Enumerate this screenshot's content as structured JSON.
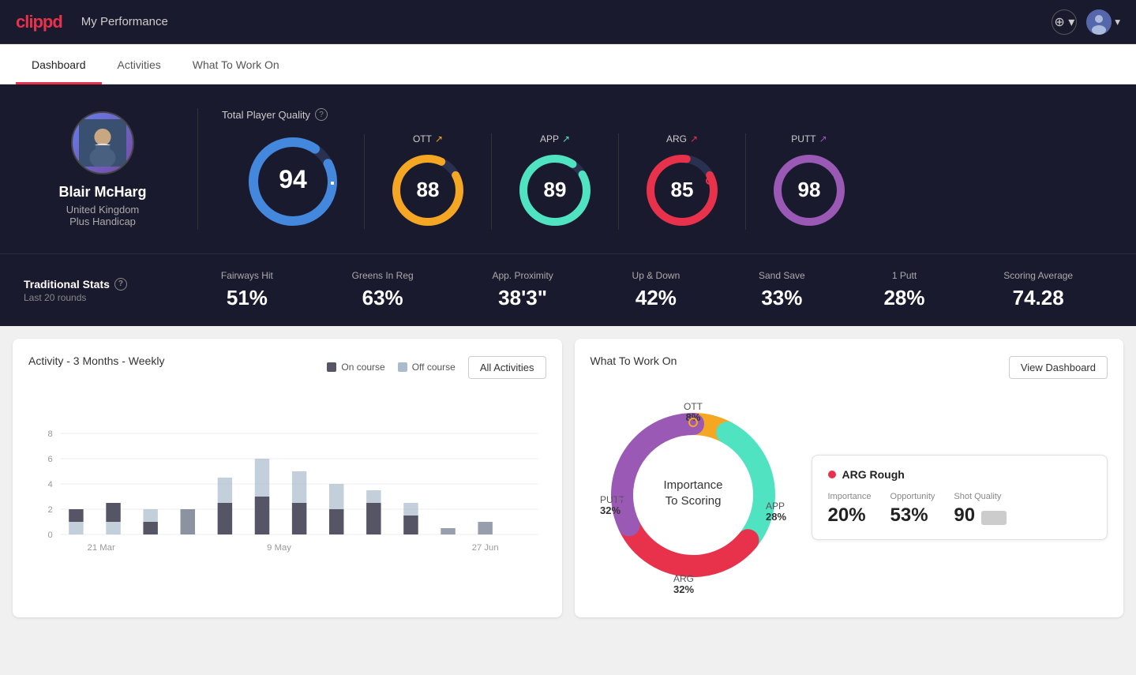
{
  "app": {
    "logo": "clippd",
    "header_title": "My Performance"
  },
  "tabs": [
    {
      "id": "dashboard",
      "label": "Dashboard",
      "active": true
    },
    {
      "id": "activities",
      "label": "Activities",
      "active": false
    },
    {
      "id": "what-to-work-on",
      "label": "What To Work On",
      "active": false
    }
  ],
  "player": {
    "name": "Blair McHarg",
    "country": "United Kingdom",
    "handicap": "Plus Handicap"
  },
  "total_quality": {
    "label": "Total Player Quality",
    "main_value": 94,
    "gauges": [
      {
        "id": "ott",
        "label": "OTT",
        "value": 88,
        "color": "#f5a623",
        "trend": "up"
      },
      {
        "id": "app",
        "label": "APP",
        "value": 89,
        "color": "#50e3c2",
        "trend": "up"
      },
      {
        "id": "arg",
        "label": "ARG",
        "value": 85,
        "color": "#e8314a",
        "trend": "up"
      },
      {
        "id": "putt",
        "label": "PUTT",
        "value": 98,
        "color": "#9b59b6",
        "trend": "up"
      }
    ]
  },
  "traditional_stats": {
    "label": "Traditional Stats",
    "sublabel": "Last 20 rounds",
    "stats": [
      {
        "label": "Fairways Hit",
        "value": "51%"
      },
      {
        "label": "Greens In Reg",
        "value": "63%"
      },
      {
        "label": "App. Proximity",
        "value": "38'3\""
      },
      {
        "label": "Up & Down",
        "value": "42%"
      },
      {
        "label": "Sand Save",
        "value": "33%"
      },
      {
        "label": "1 Putt",
        "value": "28%"
      },
      {
        "label": "Scoring Average",
        "value": "74.28"
      }
    ]
  },
  "activity_chart": {
    "title": "Activity - 3 Months - Weekly",
    "legend": [
      {
        "label": "On course",
        "color": "#555566"
      },
      {
        "label": "Off course",
        "color": "#aabbcc"
      }
    ],
    "all_activities_btn": "All Activities",
    "x_labels": [
      "21 Mar",
      "9 May",
      "27 Jun"
    ],
    "y_labels": [
      "0",
      "2",
      "4",
      "6",
      "8"
    ],
    "bars": [
      {
        "oncourse": 1,
        "offcourse": 1.5
      },
      {
        "oncourse": 1.5,
        "offcourse": 1
      },
      {
        "oncourse": 1,
        "offcourse": 2
      },
      {
        "oncourse": 2,
        "offcourse": 2
      },
      {
        "oncourse": 2.5,
        "offcourse": 4.5
      },
      {
        "oncourse": 3,
        "offcourse": 6
      },
      {
        "oncourse": 2.5,
        "offcourse": 5
      },
      {
        "oncourse": 2,
        "offcourse": 4
      },
      {
        "oncourse": 2.5,
        "offcourse": 3
      },
      {
        "oncourse": 1.5,
        "offcourse": 2.5
      },
      {
        "oncourse": 0.5,
        "offcourse": 0.5
      },
      {
        "oncourse": 0.5,
        "offcourse": 1
      }
    ]
  },
  "what_to_work_on": {
    "title": "What To Work On",
    "view_dashboard_btn": "View Dashboard",
    "donut_center": "Importance\nTo Scoring",
    "segments": [
      {
        "label": "OTT",
        "percent": "8%",
        "color": "#f5a623"
      },
      {
        "label": "APP",
        "percent": "28%",
        "color": "#50e3c2"
      },
      {
        "label": "ARG",
        "percent": "32%",
        "color": "#e8314a"
      },
      {
        "label": "PUTT",
        "percent": "32%",
        "color": "#9b59b6"
      }
    ],
    "info_card": {
      "title": "ARG Rough",
      "metrics": [
        {
          "label": "Importance",
          "value": "20%"
        },
        {
          "label": "Opportunity",
          "value": "53%"
        },
        {
          "label": "Shot Quality",
          "value": "90"
        }
      ]
    }
  },
  "icons": {
    "plus": "⊕",
    "chevron_down": "▾",
    "help": "?"
  }
}
